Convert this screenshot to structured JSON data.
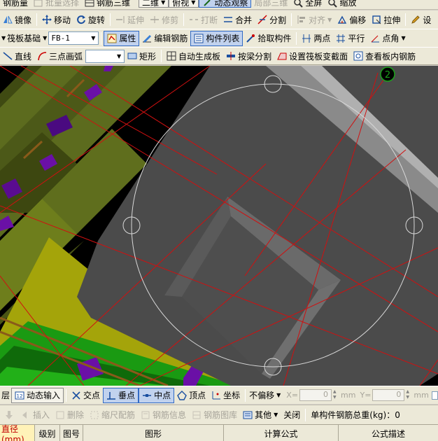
{
  "toolbar_top": {
    "items": [
      {
        "label": "钢筋量",
        "disabled": false
      },
      {
        "label": "批量选择",
        "disabled": true
      },
      {
        "label": "钢筋三维",
        "disabled": false
      },
      {
        "label": "二维",
        "disabled": false
      },
      {
        "label": "俯视",
        "disabled": false
      },
      {
        "label": "动态观察",
        "disabled": false
      },
      {
        "label": "局部三维",
        "disabled": true
      },
      {
        "label": "全屏",
        "disabled": false
      },
      {
        "label": "缩放",
        "disabled": false
      }
    ]
  },
  "toolbar_edit": {
    "mirror": "镜像",
    "move": "移动",
    "rotate": "旋转",
    "extend": "延伸",
    "trim": "修剪",
    "break": "打断",
    "merge": "合并",
    "split": "分割",
    "align": "对齐",
    "offset": "偏移",
    "stretch": "拉伸",
    "settings": "设"
  },
  "toolbar_element": {
    "category": "筏板基础",
    "element": "FB-1",
    "properties": "属性",
    "edit_rebar": "编辑钢筋",
    "element_list": "构件列表",
    "pick_element": "拾取构件",
    "two_points": "两点",
    "parallel": "平行",
    "point_angle": "点角"
  },
  "toolbar_draw": {
    "line": "直线",
    "arc": "三点画弧",
    "shape_select": "",
    "rectangle": "矩形",
    "auto_slab": "自动生成板",
    "split_by_beam": "按梁分割",
    "set_raft_section": "设置筏板变截面",
    "view_slab_rebar": "查看板内钢筋"
  },
  "viewport": {
    "axis_marker": "2",
    "colors": {
      "background": "#000000",
      "slab": "#4b4b4b",
      "slab_top_edge": "#9a9a9a",
      "grid_line": "#d01010",
      "wall_green": "#5c6b1e",
      "wall_yellow": "#a4a40a",
      "wall_green_bright": "#1a9a12",
      "purple": "#6a10a6",
      "orbit_circle": "#d8d8d8"
    }
  },
  "snapbar": {
    "ortho": "层",
    "dynamic_input": "动态输入",
    "intersection": "交点",
    "perpendicular": "垂点",
    "midpoint": "中点",
    "vertex": "顶点",
    "coordinate": "坐标",
    "offset_mode": "不偏移",
    "x_label": "X=",
    "x_value": "0",
    "y_label": "Y=",
    "y_value": "0",
    "unit": "mm"
  },
  "bottombar": {
    "insert": "插入",
    "delete": "删除",
    "scale_rebar": "缩尺配筋",
    "rebar_info": "钢筋信息",
    "rebar_library": "钢筋图库",
    "other": "其他",
    "close": "关闭",
    "total_weight_label": "单构件钢筋总重(kg)：",
    "total_weight_value": "0"
  },
  "table": {
    "columns": [
      "直径(mm)",
      "级别",
      "图号",
      "图形",
      "计算公式",
      "公式描述"
    ]
  }
}
